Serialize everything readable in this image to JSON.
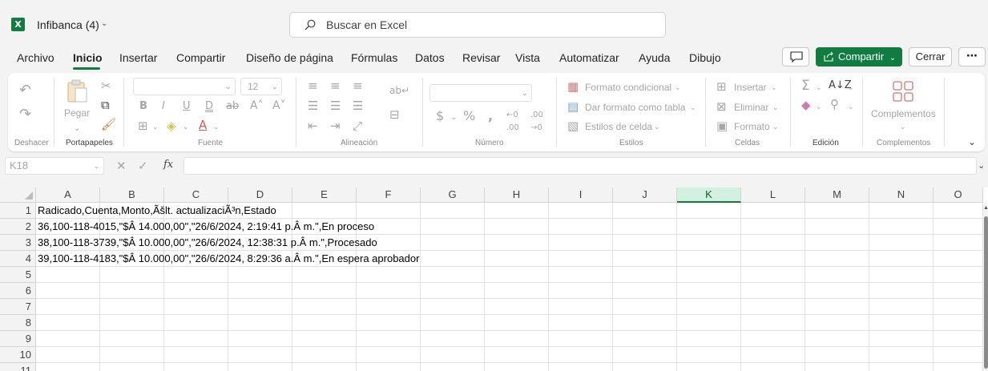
{
  "app": {
    "title": "Infibanca (4)"
  },
  "search": {
    "placeholder": "Buscar en Excel"
  },
  "tabs": [
    {
      "label": "Archivo"
    },
    {
      "label": "Inicio"
    },
    {
      "label": "Insertar"
    },
    {
      "label": "Compartir"
    },
    {
      "label": "Diseño de página"
    },
    {
      "label": "Fórmulas"
    },
    {
      "label": "Datos"
    },
    {
      "label": "Revisar"
    },
    {
      "label": "Vista"
    },
    {
      "label": "Automatizar"
    },
    {
      "label": "Ayuda"
    },
    {
      "label": "Dibujo"
    }
  ],
  "header_actions": {
    "share": "Compartir",
    "close": "Cerrar"
  },
  "ribbon": {
    "undo_label": "Deshacer",
    "paste_label": "Pegar",
    "clipboard_label": "Portapapeles",
    "font_size": "12",
    "font_label": "Fuente",
    "alignment_label": "Alineación",
    "number_label": "Número",
    "styles": {
      "conditional": "Formato condicional",
      "table": "Dar formato como tabla",
      "cell_styles": "Estilos de celda",
      "label": "Estilos"
    },
    "cells": {
      "insert": "Insertar",
      "delete": "Eliminar",
      "format": "Formato",
      "label": "Celdas"
    },
    "editing_label": "Edición",
    "addins": {
      "button": "Complementos",
      "label": "Complementos"
    }
  },
  "formula_bar": {
    "name_box": "K18",
    "value": ""
  },
  "grid": {
    "columns": [
      "A",
      "B",
      "C",
      "D",
      "E",
      "F",
      "G",
      "H",
      "I",
      "J",
      "K",
      "L",
      "M",
      "N",
      "O"
    ],
    "selected_column": "K",
    "rows": [
      "1",
      "2",
      "3",
      "4",
      "5",
      "6",
      "7",
      "8",
      "9",
      "10",
      "11"
    ],
    "cells": [
      "Radicado,Cuenta,Monto,Ãšlt. actualizaciÃ³n,Estado",
      "36,100-118-4015,\"$Â 14.000,00\",\"26/6/2024, 2:19:41 p.Â m.\",En proceso",
      "38,100-118-3739,\"$Â 10.000,00\",\"26/6/2024, 12:38:31 p.Â m.\",Procesado",
      "39,100-118-4183,\"$Â 10.000,00\",\"26/6/2024, 8:29:36 a.Â m.\",En espera aprobador"
    ]
  },
  "colors": {
    "accent": "#107c41",
    "selected_header": "#d3f0e0"
  }
}
